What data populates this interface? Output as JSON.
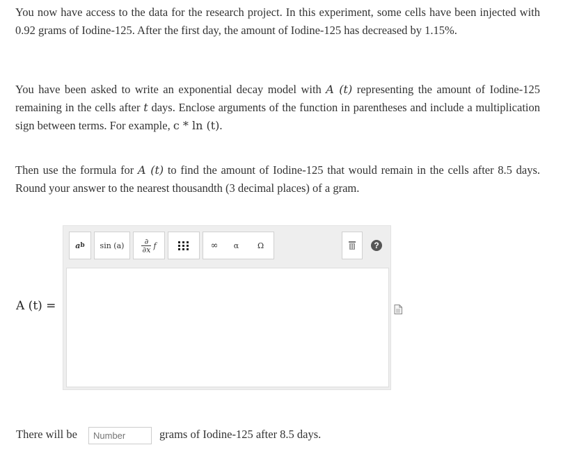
{
  "paragraphs": {
    "p1": "You now have access to the data for the research project. In this experiment, some cells have been injected with 0.92 grams of Iodine-125. After the first day, the amount of Iodine-125 has decreased by 1.15%.",
    "p2_a": "You have been asked to write an exponential decay model with ",
    "p2_math1": "A (t)",
    "p2_b": " representing the amount of Iodine-125 remaining in the cells after ",
    "p2_math2": "t",
    "p2_c": " days. Enclose arguments of the function in parentheses and include a multiplication sign between terms. For example, ",
    "p2_math3": "c * ln (t)",
    "p2_d": ".",
    "p3_a": "Then use the formula for ",
    "p3_math1": "A (t)",
    "p3_b": " to find the amount of Iodine-125 that would remain in the cells after 8.5 days. Round your answer to the nearest thousandth (3 decimal places) of a gram."
  },
  "editor": {
    "label": "A (t) =",
    "toolbar": {
      "power_base": "a",
      "power_exp": "b",
      "sin_label": "sin (a)",
      "deriv_num": "∂",
      "deriv_den": "∂x",
      "deriv_f": "f",
      "infinity": "∞",
      "alpha": "α",
      "omega": "Ω",
      "trash": "▥",
      "help": "?"
    },
    "value": ""
  },
  "answer": {
    "prefix": "There will be",
    "placeholder": "Number",
    "suffix": "grams of Iodine-125 after 8.5 days."
  }
}
